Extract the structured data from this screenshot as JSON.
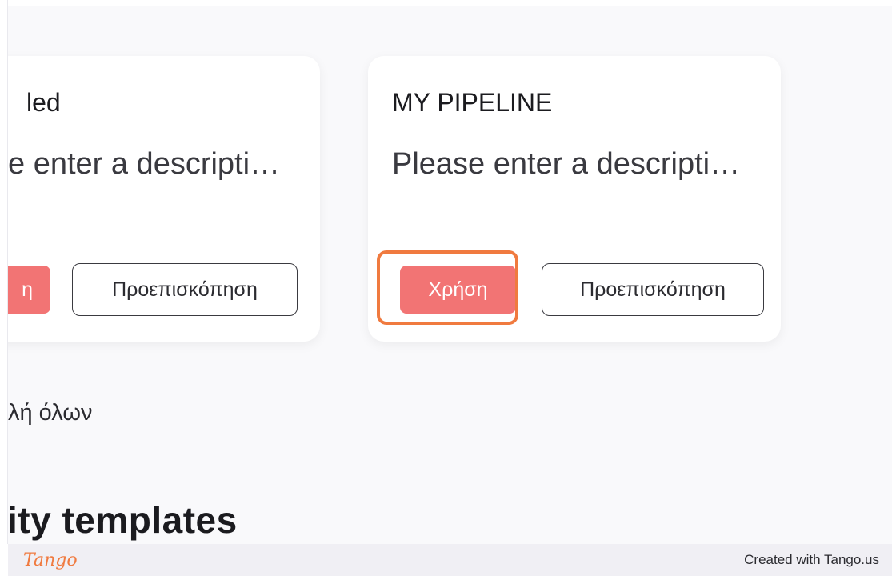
{
  "cards": [
    {
      "title": "led",
      "description": "e enter a descripti…",
      "use_label": "η",
      "preview_label": "Προεπισκόπηση"
    },
    {
      "title": "MY PIPELINE",
      "description": "Please enter a descripti…",
      "use_label": "Χρήση",
      "preview_label": "Προεπισκόπηση"
    }
  ],
  "show_all_link": "λή όλων",
  "section_heading": "ity templates",
  "footer": {
    "logo": "Tango",
    "credit": "Created with Tango.us"
  },
  "colors": {
    "use_button": "#f27474",
    "highlight": "#f07a3f",
    "background": "#f9f9fb",
    "footer": "#f0eff4"
  }
}
